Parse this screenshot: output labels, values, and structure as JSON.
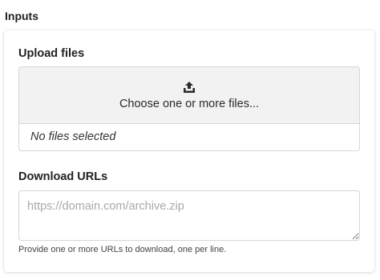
{
  "section": {
    "title": "Inputs"
  },
  "upload": {
    "label": "Upload files",
    "icon": "upload-icon",
    "prompt": "Choose one or more files...",
    "status": "No files selected"
  },
  "download": {
    "label": "Download URLs",
    "placeholder": "https://domain.com/archive.zip",
    "value": "",
    "help": "Provide one or more URLs to download, one per line."
  }
}
